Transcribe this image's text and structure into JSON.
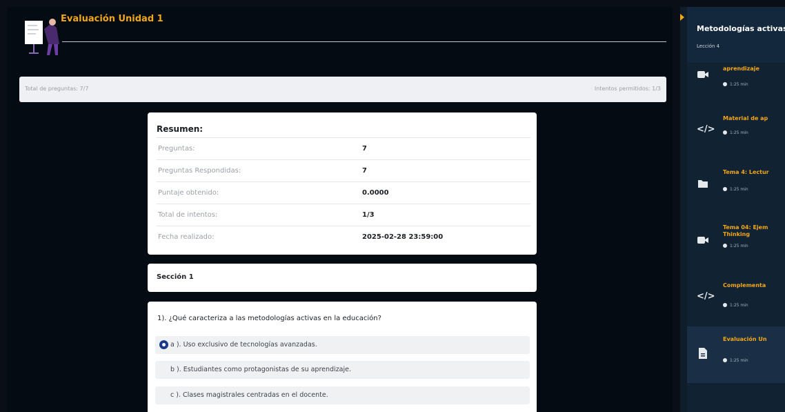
{
  "header": {
    "title": "Evaluación Unidad 1"
  },
  "info_bar": {
    "total_questions": "Total de preguntas: 7/7",
    "attempts_allowed": "Intentos permitidos: 1/3"
  },
  "summary": {
    "title": "Resumen:",
    "rows": [
      {
        "label": "Preguntas:",
        "value": "7"
      },
      {
        "label": "Preguntas Respondidas:",
        "value": "7"
      },
      {
        "label": "Puntaje obtenido:",
        "value": "0.0000"
      },
      {
        "label": "Total de intentos:",
        "value": "1/3"
      },
      {
        "label": "Fecha realizado:",
        "value": "2025-02-28 23:59:00"
      }
    ]
  },
  "section": {
    "title": "Sección 1"
  },
  "question": {
    "text": "1). ¿Qué caracteriza a las metodologías activas en la educación?",
    "options": [
      {
        "label": "a ). Uso exclusivo de tecnologías avanzadas.",
        "selected": true
      },
      {
        "label": "b ). Estudiantes como protagonistas de su aprendizaje.",
        "selected": false
      },
      {
        "label": "c ). Clases magistrales centradas en el docente.",
        "selected": false
      }
    ]
  },
  "sidebar": {
    "course_title": "Metodologías activas",
    "lesson": "Lección 4",
    "items": [
      {
        "icon": "video-icon",
        "title": "aprendizaje",
        "time": "1:25 min"
      },
      {
        "icon": "code-icon",
        "title": "Material de ap",
        "time": "1:25 min"
      },
      {
        "icon": "folder-icon",
        "title": "Tema 4: Lectur",
        "time": "1:25 min"
      },
      {
        "icon": "video-icon",
        "title": "Tema 04: Ejem",
        "title2": "Thinking",
        "time": "1:25 min"
      },
      {
        "icon": "code-icon",
        "title": "Complementa",
        "time": "1:25 min"
      },
      {
        "icon": "document-icon",
        "title": "Evaluación Un",
        "time": "1:25 min"
      }
    ]
  },
  "colors": {
    "accent": "#f2a71b",
    "radio": "#1b3a8c",
    "background": "#050b12",
    "sidebar": "#112233"
  }
}
